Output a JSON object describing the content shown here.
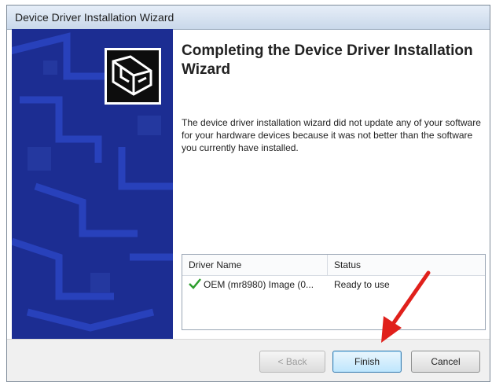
{
  "window": {
    "title": "Device Driver Installation Wizard"
  },
  "heading": "Completing the Device Driver Installation Wizard",
  "description": "The device driver installation wizard did not update any of your software for your hardware devices because it was not better than the software you currently have installed.",
  "driver_list": {
    "columns": [
      "Driver Name",
      "Status"
    ],
    "rows": [
      {
        "name": "OEM (mr8980) Image  (0...",
        "status": "Ready to use",
        "icon": "green-check-icon"
      }
    ]
  },
  "buttons": {
    "back": "< Back",
    "finish": "Finish",
    "cancel": "Cancel"
  },
  "colors": {
    "banner": "#1c2d92",
    "check": "#2e9e2e",
    "annotation_arrow": "#e0201b"
  },
  "annotation": {
    "icon": "red-arrow-icon",
    "points_to": "finish-button"
  }
}
